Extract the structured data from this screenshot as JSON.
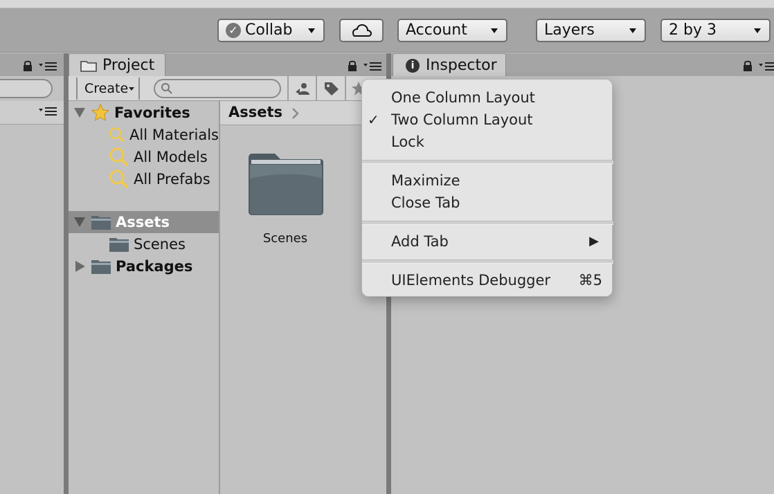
{
  "toolbar": {
    "collab_label": "Collab",
    "account_label": "Account",
    "layers_label": "Layers",
    "layout_label": "2 by 3"
  },
  "tabs": {
    "project_label": "Project",
    "inspector_label": "Inspector"
  },
  "project": {
    "create_label": "Create",
    "search_placeholder": "",
    "favorites": {
      "label": "Favorites",
      "items": [
        "All Materials",
        "All Models",
        "All Prefabs"
      ]
    },
    "assets_label": "Assets",
    "assets_children": [
      "Scenes"
    ],
    "packages_label": "Packages",
    "breadcrumb": "Assets",
    "grid_items": [
      "Scenes"
    ]
  },
  "context_menu": {
    "items": [
      {
        "label": "One Column Layout",
        "checked": false
      },
      {
        "label": "Two Column Layout",
        "checked": true
      },
      {
        "label": "Lock",
        "checked": false
      },
      {
        "label": "Maximize",
        "checked": false
      },
      {
        "label": "Close Tab",
        "checked": false
      },
      {
        "label": "Add Tab",
        "submenu": true
      },
      {
        "label": "UIElements Debugger",
        "shortcut": "⌘5"
      }
    ],
    "check_mark": "✓",
    "submenu_arrow": "▶"
  },
  "colors": {
    "toolbar_bg": "#a5a5a5",
    "pane_bg": "#c2c2c2",
    "selection": "#8e8e8e",
    "folder": "#5b6870",
    "search_icon": "#f2c94c"
  }
}
